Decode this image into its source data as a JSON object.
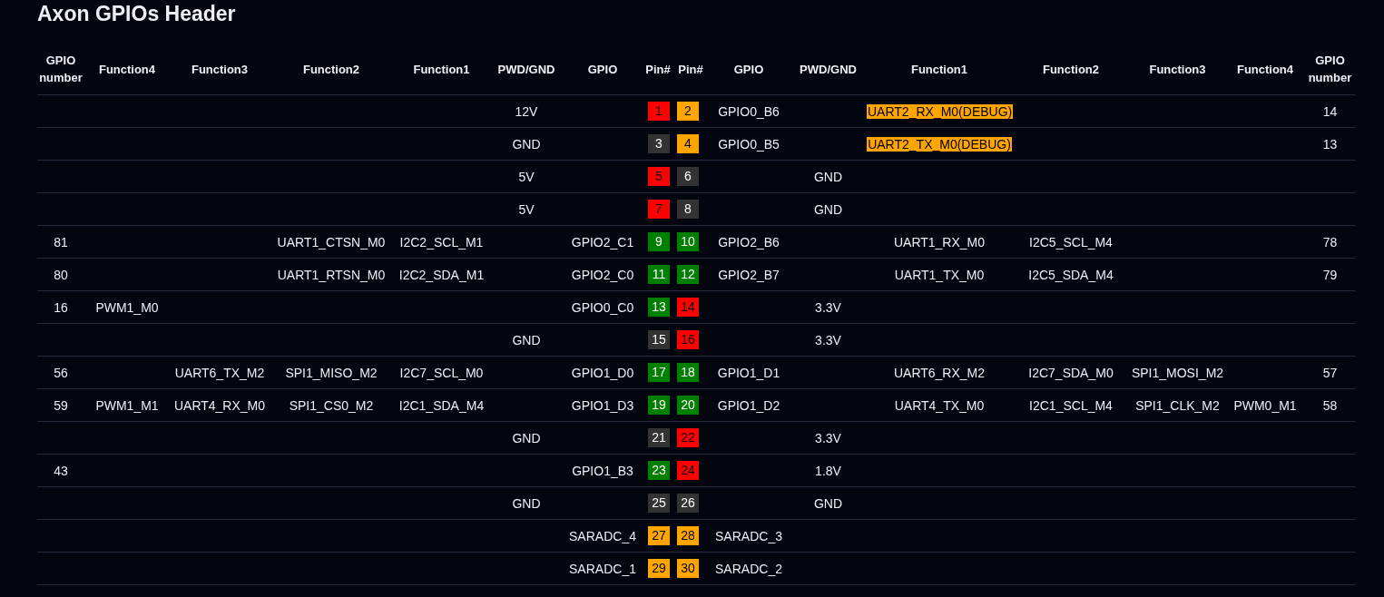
{
  "title": "Axon GPIOs Header",
  "columns": [
    "GPIO number",
    "Function4",
    "Function3",
    "Function2",
    "Function1",
    "PWD/GND",
    "GPIO",
    "Pin#",
    "Pin#",
    "GPIO",
    "PWD/GND",
    "Function1",
    "Function2",
    "Function3",
    "Function4",
    "GPIO number"
  ],
  "rows": [
    {
      "left": {
        "pwr_gnd": "12V",
        "pin": {
          "number": "1",
          "color": "#ff0000"
        }
      },
      "right": {
        "pin": {
          "number": "2",
          "color": "#ffa500"
        },
        "gpio": "GPIO0_B6",
        "function1": "UART2_RX_M0(DEBUG)",
        "function1_highlighted": true,
        "gpio_number": "14"
      }
    },
    {
      "left": {
        "pwr_gnd": "GND",
        "pin": {
          "number": "3",
          "color": "#333333"
        }
      },
      "right": {
        "pin": {
          "number": "4",
          "color": "#ffa500"
        },
        "gpio": "GPIO0_B5",
        "function1": "UART2_TX_M0(DEBUG)",
        "function1_highlighted": true,
        "gpio_number": "13"
      }
    },
    {
      "left": {
        "pwr_gnd": "5V",
        "pin": {
          "number": "5",
          "color": "#ff0000"
        }
      },
      "right": {
        "pin": {
          "number": "6",
          "color": "#333333"
        },
        "pwr_gnd": "GND"
      }
    },
    {
      "left": {
        "pwr_gnd": "5V",
        "pin": {
          "number": "7",
          "color": "#ff0000"
        }
      },
      "right": {
        "pin": {
          "number": "8",
          "color": "#333333"
        },
        "pwr_gnd": "GND"
      }
    },
    {
      "left": {
        "gpio_number": "81",
        "function2": "UART1_CTSN_M0",
        "function1": "I2C2_SCL_M1",
        "gpio": "GPIO2_C1",
        "pin": {
          "number": "9",
          "color": "#008000"
        }
      },
      "right": {
        "pin": {
          "number": "10",
          "color": "#008000"
        },
        "gpio": "GPIO2_B6",
        "function1": "UART1_RX_M0",
        "function1_highlighted": false,
        "function2": "I2C5_SCL_M4",
        "gpio_number": "78"
      }
    },
    {
      "left": {
        "gpio_number": "80",
        "function2": "UART1_RTSN_M0",
        "function1": "I2C2_SDA_M1",
        "gpio": "GPIO2_C0",
        "pin": {
          "number": "11",
          "color": "#008000"
        }
      },
      "right": {
        "pin": {
          "number": "12",
          "color": "#008000"
        },
        "gpio": "GPIO2_B7",
        "function1": "UART1_TX_M0",
        "function1_highlighted": false,
        "function2": "I2C5_SDA_M4",
        "gpio_number": "79"
      }
    },
    {
      "left": {
        "gpio_number": "16",
        "function4": "PWM1_M0",
        "gpio": "GPIO0_C0",
        "pin": {
          "number": "13",
          "color": "#008000"
        }
      },
      "right": {
        "pin": {
          "number": "14",
          "color": "#ff0000"
        },
        "pwr_gnd": "3.3V"
      }
    },
    {
      "left": {
        "pwr_gnd": "GND",
        "pin": {
          "number": "15",
          "color": "#333333"
        }
      },
      "right": {
        "pin": {
          "number": "16",
          "color": "#ff0000"
        },
        "pwr_gnd": "3.3V"
      }
    },
    {
      "left": {
        "gpio_number": "56",
        "function3": "UART6_TX_M2",
        "function2": "SPI1_MISO_M2",
        "function1": "I2C7_SCL_M0",
        "gpio": "GPIO1_D0",
        "pin": {
          "number": "17",
          "color": "#008000"
        }
      },
      "right": {
        "pin": {
          "number": "18",
          "color": "#008000"
        },
        "gpio": "GPIO1_D1",
        "function1": "UART6_RX_M2",
        "function1_highlighted": false,
        "function2": "I2C7_SDA_M0",
        "function3": "SPI1_MOSI_M2",
        "gpio_number": "57"
      }
    },
    {
      "left": {
        "gpio_number": "59",
        "function4": "PWM1_M1",
        "function3": "UART4_RX_M0",
        "function2": "SPI1_CS0_M2",
        "function1": "I2C1_SDA_M4",
        "gpio": "GPIO1_D3",
        "pin": {
          "number": "19",
          "color": "#008000"
        }
      },
      "right": {
        "pin": {
          "number": "20",
          "color": "#008000"
        },
        "gpio": "GPIO1_D2",
        "function1": "UART4_TX_M0",
        "function1_highlighted": false,
        "function2": "I2C1_SCL_M4",
        "function3": "SPI1_CLK_M2",
        "function4": "PWM0_M1",
        "gpio_number": "58"
      }
    },
    {
      "left": {
        "pwr_gnd": "GND",
        "pin": {
          "number": "21",
          "color": "#333333"
        }
      },
      "right": {
        "pin": {
          "number": "22",
          "color": "#ff0000"
        },
        "pwr_gnd": "3.3V"
      }
    },
    {
      "left": {
        "gpio_number": "43",
        "gpio": "GPIO1_B3",
        "pin": {
          "number": "23",
          "color": "#008000"
        }
      },
      "right": {
        "pin": {
          "number": "24",
          "color": "#ff0000"
        },
        "pwr_gnd": "1.8V"
      }
    },
    {
      "left": {
        "pwr_gnd": "GND",
        "pin": {
          "number": "25",
          "color": "#333333"
        }
      },
      "right": {
        "pin": {
          "number": "26",
          "color": "#333333"
        },
        "pwr_gnd": "GND"
      }
    },
    {
      "left": {
        "gpio": "SARADC_4",
        "pin": {
          "number": "27",
          "color": "#ffa500"
        }
      },
      "right": {
        "pin": {
          "number": "28",
          "color": "#ffa500"
        },
        "gpio": "SARADC_3"
      }
    },
    {
      "left": {
        "gpio": "SARADC_1",
        "pin": {
          "number": "29",
          "color": "#ffa500"
        }
      },
      "right": {
        "pin": {
          "number": "30",
          "color": "#ffa500"
        },
        "gpio": "SARADC_2"
      }
    }
  ]
}
